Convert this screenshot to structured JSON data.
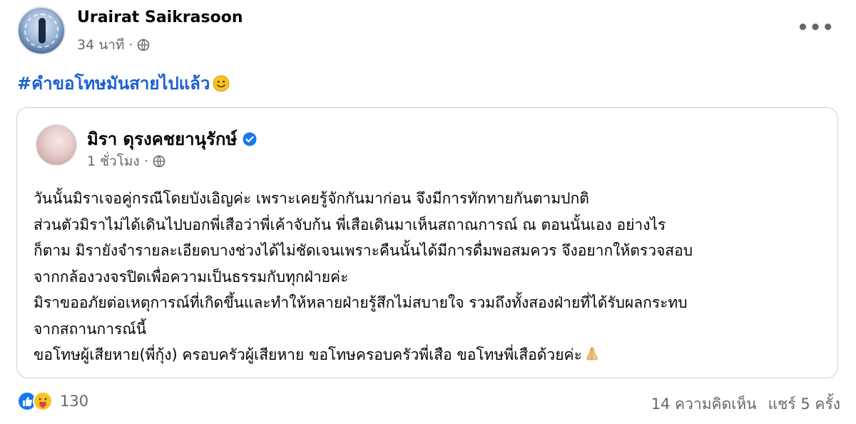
{
  "post": {
    "author": "Urairat Saikrasoon",
    "time": "34 นาที",
    "separator": "·",
    "privacy_icon": "globe-icon",
    "more_icon": "more-options-icon",
    "hashtag": "#คำขอโทษมันสายไปแล้ว",
    "hashtag_emoji": "slightly-smiling-face"
  },
  "shared_post": {
    "author": "มิรา ดุรงคชยานุรักษ์",
    "verified": true,
    "time": "1 ชั่วโมง",
    "separator": "·",
    "privacy_icon": "globe-icon",
    "lines": [
      "วันนั้นมิราเจอคู่กรณีโดยบังเอิญค่ะ เพราะเคยรู้จักกันมาก่อน จึงมีการทักทายกันตามปกติ",
      "ส่วนตัวมิราไม่ได้เดินไปบอกพี่เสือว่าพี่เค้าจับก้น พี่เสือเดินมาเห็นสถาณการณ์ ณ ตอนนั้นเอง อย่างไร",
      "ก็ตาม มิรายังจำรายละเอียดบางช่วงได้ไม่ชัดเจนเพราะคืนนั้นได้มีการดื่มพอสมควร จึงอยากให้ตรวจสอบ",
      "จากกล้องวงจรปิดเพื่อความเป็นธรรมกับทุกฝ่ายค่ะ",
      "มิราขออภัยต่อเหตุการณ์ที่เกิดขึ้นและทำให้หลายฝ่ายรู้สึกไม่สบายใจ รวมถึงทั้งสองฝ่ายที่ได้รับผลกระทบ",
      "จากสถานการณ์นี้",
      "ขอโทษผู้เสียหาย(พี่กุ้ง) ครอบครัวผู้เสียหาย ขอโทษครอบครัวพี่เสือ ขอโทษพี่เสือด้วยค่ะ"
    ],
    "closing_emoji": "praying-hands"
  },
  "footer": {
    "reaction_icons": [
      "like-icon",
      "care-icon"
    ],
    "reaction_count": "130",
    "comments": "14 ความคิดเห็น",
    "shares": "แชร์ 5 ครั้ง"
  },
  "colors": {
    "hashtag": "#1b5fd1",
    "secondary_text": "#65676b",
    "verified": "#1877f2",
    "like": "#1877f2",
    "border": "#ced0d4"
  }
}
